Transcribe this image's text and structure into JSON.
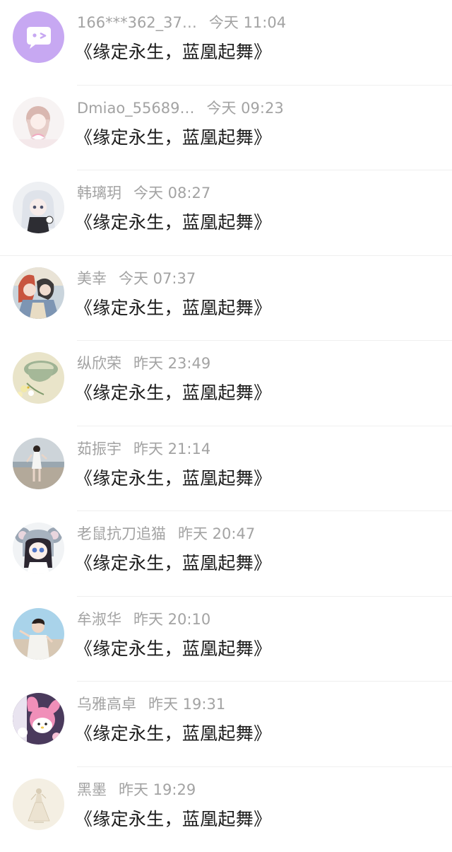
{
  "messages": [
    {
      "name": "166***362_37…",
      "time": "今天  11:04",
      "text": "《缘定永生，蓝凰起舞》",
      "avatar": "chat-bubble-avatar"
    },
    {
      "name": "Dmiao_55689…",
      "time": "今天  09:23",
      "text": "《缘定永生，蓝凰起舞》",
      "avatar": "anime-girl-bow-avatar"
    },
    {
      "name": "韩璃玥",
      "time": "今天  08:27",
      "text": "《缘定永生，蓝凰起舞》",
      "avatar": "anime-girl-white-hair-avatar"
    },
    {
      "name": "美幸",
      "time": "今天  07:37",
      "text": "《缘定永生，蓝凰起舞》",
      "avatar": "anime-couple-avatar"
    },
    {
      "name": "纵欣荣",
      "time": "昨天  23:49",
      "text": "《缘定永生，蓝凰起舞》",
      "avatar": "flower-cup-avatar"
    },
    {
      "name": "茹振宇",
      "time": "昨天  21:14",
      "text": "《缘定永生，蓝凰起舞》",
      "avatar": "girl-beach-photo-avatar"
    },
    {
      "name": "老鼠抗刀追猫",
      "time": "昨天  20:47",
      "text": "《缘定永生，蓝凰起舞》",
      "avatar": "koala-hood-girl-avatar"
    },
    {
      "name": "牟淑华",
      "time": "昨天  20:10",
      "text": "《缘定永生，蓝凰起舞》",
      "avatar": "boy-sky-photo-avatar"
    },
    {
      "name": "乌雅高卓",
      "time": "昨天  19:31",
      "text": "《缘定永生，蓝凰起舞》",
      "avatar": "my-melody-avatar"
    },
    {
      "name": "黑墨",
      "time": "昨天  19:29",
      "text": "《缘定永生，蓝凰起舞》",
      "avatar": "sketch-dress-avatar"
    }
  ],
  "colors": {
    "name_text": "#a3a3a3",
    "message_text": "#1c1c1c",
    "divider": "#efefef",
    "default_avatar_bg": "#c7a8f2"
  }
}
